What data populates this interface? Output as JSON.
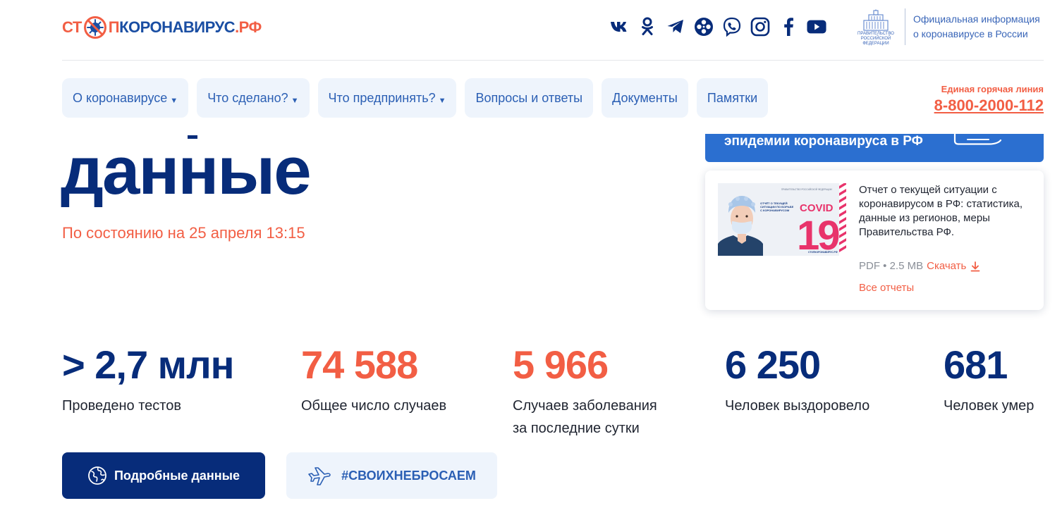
{
  "header": {
    "logo": {
      "part1": "СТ",
      "part2": "П",
      "part3": "КОРОНАВИРУС",
      "part4": ".РФ"
    },
    "socials": [
      {
        "name": "vk-icon"
      },
      {
        "name": "odnoklassniki-icon"
      },
      {
        "name": "telegram-icon"
      },
      {
        "name": "reel-icon"
      },
      {
        "name": "viber-icon"
      },
      {
        "name": "instagram-icon"
      },
      {
        "name": "facebook-icon"
      },
      {
        "name": "youtube-icon"
      }
    ],
    "gov": {
      "emblem_caption_1": "ПРАВИТЕЛЬСТВО",
      "emblem_caption_2": "РОССИЙСКОЙ",
      "emblem_caption_3": "ФЕДЕРАЦИИ",
      "line1": "Официальная информация",
      "line2": "о коронавирусе в России"
    }
  },
  "nav": {
    "items": [
      {
        "label": "О коронавирусе",
        "dropdown": true
      },
      {
        "label": "Что сделано?",
        "dropdown": true
      },
      {
        "label": "Что предпринять?",
        "dropdown": true
      },
      {
        "label": "Вопросы и ответы",
        "dropdown": false
      },
      {
        "label": "Документы",
        "dropdown": false
      },
      {
        "label": "Памятки",
        "dropdown": false
      }
    ],
    "caret": "▼"
  },
  "hotline": {
    "label": "Единая горячая линия",
    "phone": "8-800-2000-112"
  },
  "main": {
    "title": "данные",
    "as_of": "По состоянию на 25 апреля 13:15"
  },
  "banner": {
    "text": "эпидемии коронавируса в РФ"
  },
  "report": {
    "thumb": {
      "covid": "COVID",
      "number": "19",
      "caption_1": "ОТЧЁТ О ТЕКУЩЕЙ",
      "caption_2": "СИТУАЦИИ ПО БОРЬБЕ",
      "caption_3": "С КОРОНАВИРУСОМ",
      "brand": "СТОПКОРОНАВИРУС.РФ"
    },
    "title": "Отчет о текущей ситуации с коронавирусом в РФ: статистика, данные из регионов, меры Правительства РФ.",
    "format": "PDF • 2.5 MB",
    "download": "Скачать",
    "all_reports": "Все отчеты"
  },
  "stats": [
    {
      "value": "> 2,7 млн",
      "label": "Проведено тестов",
      "label2": "",
      "color": "blue"
    },
    {
      "value": "74 588",
      "label": "Общее число случаев",
      "label2": "",
      "color": "red"
    },
    {
      "value": "5 966",
      "label": "Случаев заболевания",
      "label2": "за последние сутки",
      "color": "red"
    },
    {
      "value": "6 250",
      "label": "Человек выздоровело",
      "label2": "",
      "color": "blue"
    },
    {
      "value": "681",
      "label": "Человек умер",
      "label2": "",
      "color": "blue"
    }
  ],
  "buttons": {
    "details": "Подробные данные",
    "hashtag": "#СВОИХНЕБРОСАЕМ"
  },
  "colors": {
    "brand_red": "#f25e44",
    "brand_blue": "#072c7a",
    "link_blue": "#2b5fb4",
    "nav_bg": "#eef4fc",
    "banner_blue": "#2b6fd0"
  }
}
